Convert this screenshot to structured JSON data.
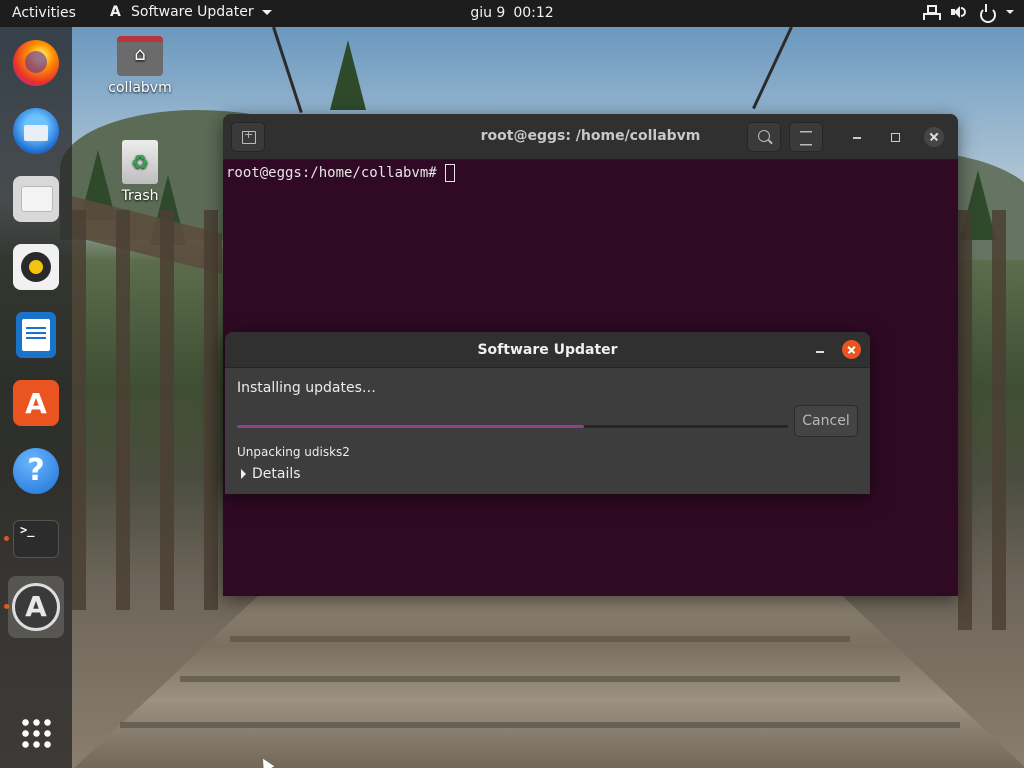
{
  "topbar": {
    "activities": "Activities",
    "app_name": "Software Updater",
    "date": "giu 9",
    "time": "00:12",
    "icons": [
      "network-icon",
      "volume-icon",
      "power-icon"
    ]
  },
  "dock": {
    "items": [
      {
        "name": "firefox",
        "icon": "firefox-icon",
        "running": false
      },
      {
        "name": "thunderbird",
        "icon": "thunderbird-icon",
        "running": false
      },
      {
        "name": "files",
        "icon": "files-icon",
        "running": false
      },
      {
        "name": "rhythmbox",
        "icon": "rhythmbox-icon",
        "running": false
      },
      {
        "name": "libreoffice-writer",
        "icon": "writer-icon",
        "running": false
      },
      {
        "name": "ubuntu-software",
        "icon": "software-store-icon",
        "running": false
      },
      {
        "name": "help",
        "icon": "help-icon",
        "running": false
      },
      {
        "name": "terminal",
        "icon": "terminal-icon",
        "running": true
      },
      {
        "name": "software-updater",
        "icon": "software-updater-icon",
        "running": true,
        "active": true
      }
    ],
    "show_apps_icon": "app-grid-icon"
  },
  "desktop": {
    "icons": [
      {
        "label": "collabvm",
        "icon": "home-folder-icon"
      },
      {
        "label": "Trash",
        "icon": "trash-icon"
      }
    ]
  },
  "terminal": {
    "title": "root@eggs: /home/collabvm",
    "prompt": "root@eggs:/home/collabvm#"
  },
  "updater": {
    "title": "Software Updater",
    "status_heading": "Installing updates…",
    "progress": 0.63,
    "cancel_label": "Cancel",
    "current_task": "Unpacking udisks2",
    "details_label": "Details",
    "colors": {
      "progress_fill": "#923f8a",
      "close_button": "#e95420"
    }
  },
  "theme": {
    "terminal_bg": "#300a24",
    "accent": "#e95420"
  }
}
